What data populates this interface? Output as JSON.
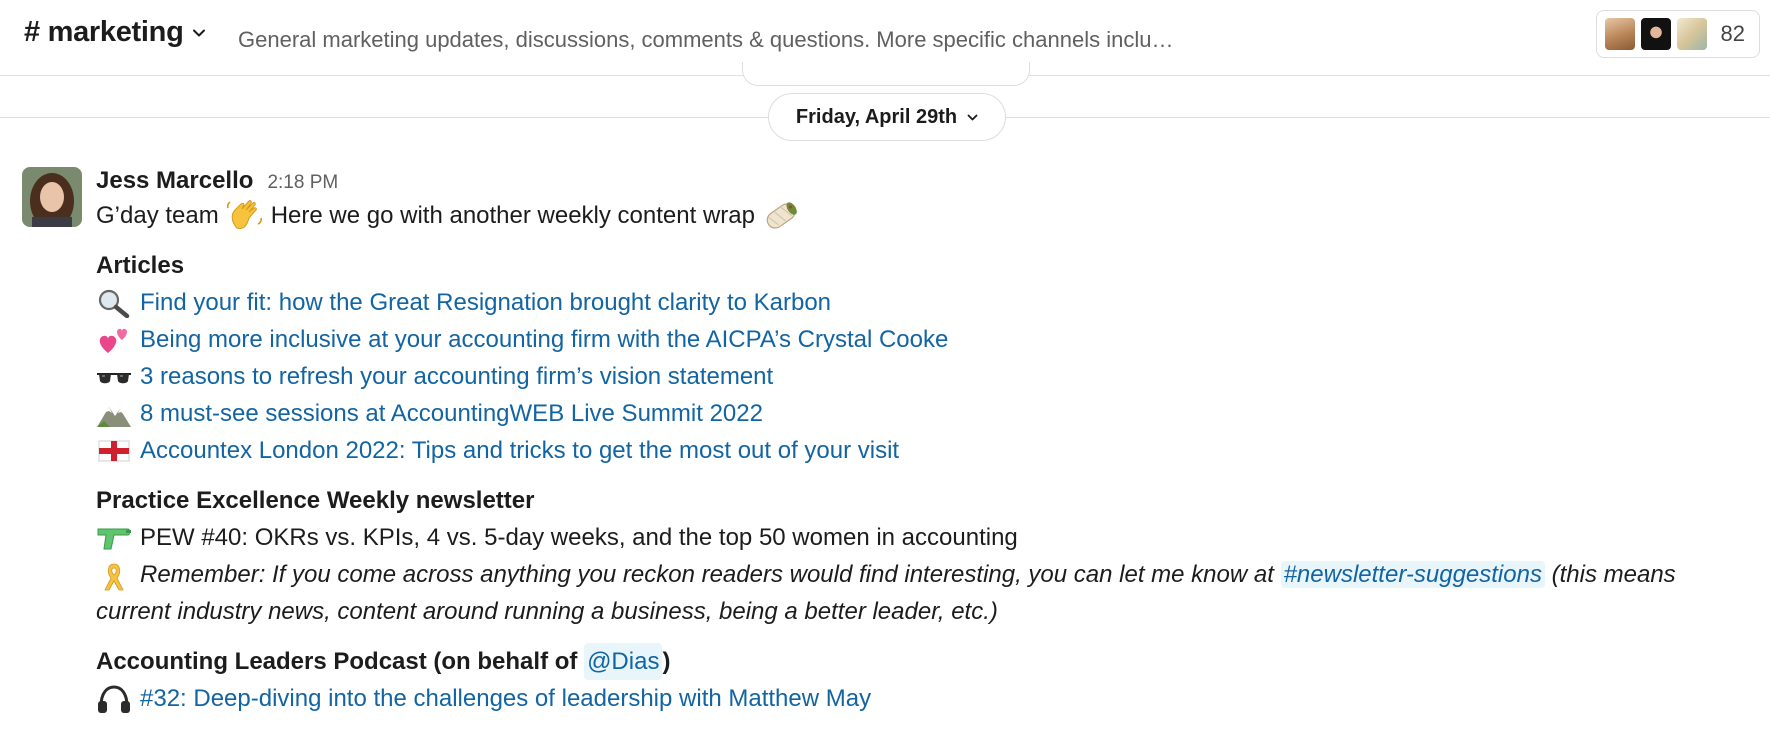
{
  "header": {
    "channel_name": "# marketing",
    "topic": "General marketing updates, discussions, comments & questions. More specific channels inclu…",
    "member_count": "82",
    "member_avatar_colors": [
      "#c9a07a",
      "#2b2b2b",
      "#d9d2b8"
    ]
  },
  "divider": {
    "date_label": "Friday, April 29th"
  },
  "message": {
    "author": "Jess Marcello",
    "timestamp": "2:18 PM",
    "greeting_start": "G’day team",
    "greeting_end": "Here we go with another weekly content wrap",
    "greeting_emojis": [
      "waving-hand",
      "burrito"
    ],
    "articles_heading": "Articles",
    "articles": [
      {
        "emoji": "magnifying-glass",
        "text": "Find your fit: how the Great Resignation brought clarity to Karbon"
      },
      {
        "emoji": "two-hearts",
        "text": "Being more inclusive at your accounting firm with the AICPA’s Crystal Cooke"
      },
      {
        "emoji": "sunglasses",
        "text": "3 reasons to refresh your accounting firm’s vision statement"
      },
      {
        "emoji": "mountain",
        "text": "8 must-see sessions at AccountingWEB Live Summit 2022"
      },
      {
        "emoji": "england-flag",
        "text": "Accountex London 2022: Tips and tricks to get the most out of your visit"
      }
    ],
    "newsletter_heading": "Practice Excellence Weekly newsletter",
    "newsletter_item": {
      "emoji": "water-pistol",
      "text": "PEW #40: OKRs vs. KPIs, 4 vs. 5-day weeks, and the top 50 women in accounting"
    },
    "remember": {
      "emoji": "reminder-ribbon",
      "text_before": "Remember: If you come across anything you reckon readers would find interesting, you can let me know at",
      "channel_mention": "#newsletter-suggestions",
      "text_after": "(this means current industry news, content around running a business, being a better leader, etc.)"
    },
    "podcast_heading_start": "Accounting Leaders Podcast (on behalf of",
    "podcast_mention": "@Dias",
    "podcast_heading_end": ")",
    "podcast_item": {
      "emoji": "headphones",
      "text": "#32: Deep-diving into the challenges of leadership with Matthew May"
    }
  }
}
